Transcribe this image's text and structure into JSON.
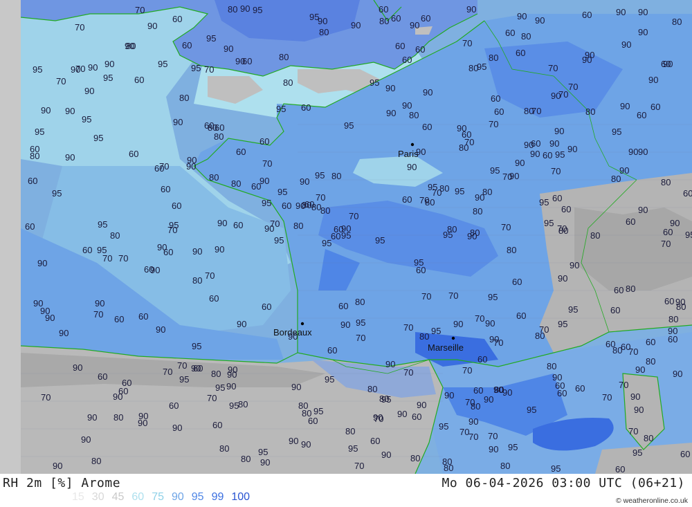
{
  "footer": {
    "title": "RH 2m [%] Arome",
    "datetime": "Mo 06-04-2026 03:00 UTC (06+21)",
    "credit_icon": "copyright-icon",
    "credit": "© weatheronline.co.uk"
  },
  "legend": [
    {
      "label": "15",
      "color": "#e8e8e8"
    },
    {
      "label": "30",
      "color": "#d8d8d8"
    },
    {
      "label": "45",
      "color": "#c9c9c9"
    },
    {
      "label": "60",
      "color": "#aee0ee"
    },
    {
      "label": "75",
      "color": "#8fd1e8"
    },
    {
      "label": "90",
      "color": "#6ea4e6"
    },
    {
      "label": "95",
      "color": "#4f86e6"
    },
    {
      "label": "99",
      "color": "#3a6ee0"
    },
    {
      "label": "100",
      "color": "#2a55d2"
    }
  ],
  "cities": [
    {
      "name": "Paris"
    },
    {
      "name": "Bordeaux"
    },
    {
      "name": "Marseille"
    }
  ],
  "labels": [
    "80",
    "80",
    "70",
    "90",
    "90",
    "90",
    "90",
    "80",
    "70",
    "70",
    "95",
    "90",
    "80",
    "90",
    "80",
    "70",
    "60",
    "95",
    "90",
    "80",
    "95",
    "90",
    "80",
    "80",
    "60",
    "80",
    "70",
    "95",
    "90",
    "95",
    "95",
    "90",
    "80",
    "60",
    "70",
    "95",
    "95",
    "90",
    "95",
    "70",
    "95",
    "90",
    "80",
    "90",
    "95",
    "95",
    "80",
    "95",
    "90",
    "80",
    "70",
    "90",
    "95",
    "95",
    "95",
    "95",
    "90",
    "80",
    "80",
    "95",
    "90",
    "80",
    "90",
    "90",
    "80",
    "70",
    "95",
    "90",
    "80",
    "90",
    "90",
    "90",
    "70",
    "90",
    "80",
    "95",
    "90",
    "80",
    "95",
    "95",
    "90",
    "90",
    "80",
    "95",
    "95",
    "90",
    "90",
    "90",
    "90",
    "80",
    "95",
    "90",
    "90",
    "80",
    "90",
    "70",
    "90",
    "80",
    "80",
    "95",
    "90",
    "80",
    "90",
    "80",
    "70",
    "95",
    "95",
    "90",
    "80",
    "90",
    "90",
    "80",
    "80",
    "95",
    "90",
    "90",
    "70",
    "60",
    "70",
    "90",
    "95",
    "95",
    "90",
    "95",
    "90",
    "90",
    "80",
    "70",
    "60",
    "60",
    "70",
    "80",
    "90",
    "95",
    "90",
    "95",
    "90",
    "90",
    "80",
    "60",
    "60",
    "70",
    "90",
    "95",
    "95",
    "90",
    "90",
    "80",
    "70",
    "80",
    "80",
    "90",
    "95",
    "90",
    "60",
    "70",
    "80",
    "90",
    "80",
    "90",
    "90",
    "90",
    "80",
    "80",
    "70",
    "90",
    "60",
    "90",
    "95",
    "60",
    "80",
    "90",
    "80",
    "80",
    "95",
    "60",
    "70",
    "80",
    "90",
    "90",
    "60",
    "70",
    "80",
    "90",
    "95",
    "90",
    "80",
    "90",
    "90",
    "95",
    "90",
    "95",
    "70",
    "70",
    "95",
    "80",
    "60",
    "70",
    "90",
    "60",
    "70",
    "90",
    "90",
    "95",
    "90",
    "60",
    "70",
    "60",
    "80",
    "90",
    "95",
    "90",
    "70",
    "60",
    "80",
    "90",
    "60",
    "60",
    "90",
    "95",
    "90",
    "80",
    "90",
    "90",
    "95",
    "60",
    "70",
    "90",
    "90",
    "80",
    "60",
    "60",
    "70",
    "60",
    "70",
    "90",
    "60",
    "60",
    "90",
    "70",
    "60",
    "60",
    "90",
    "90",
    "60",
    "80",
    "70",
    "70",
    "60",
    "60",
    "60",
    "70",
    "90",
    "80",
    "60",
    "80",
    "90",
    "80",
    "90",
    "90",
    "90",
    "95",
    "60",
    "60",
    "80",
    "60",
    "60",
    "90",
    "60",
    "70",
    "70",
    "60",
    "60",
    "60",
    "60",
    "70",
    "90",
    "60",
    "60",
    "60",
    "60",
    "90",
    "60",
    "60",
    "70",
    "70",
    "60",
    "60",
    "60",
    "60",
    "70",
    "60",
    "70",
    "70",
    "60",
    "60",
    "60",
    "90",
    "60",
    "70",
    "60",
    "60",
    "60",
    "70",
    "70",
    "90",
    "80",
    "60",
    "60",
    "95",
    "90",
    "60",
    "60",
    "70",
    "60",
    "80",
    "70",
    "80",
    "60",
    "95",
    "60",
    "90",
    "90",
    "90",
    "80",
    "60",
    "60",
    "95",
    "90",
    "60",
    "80",
    "90",
    "90",
    "80",
    "60",
    "70",
    "90",
    "70",
    "60",
    "60",
    "60",
    "80",
    "60",
    "60",
    "60",
    "90",
    "60",
    "70",
    "60",
    "90",
    "60",
    "90",
    "90",
    "60",
    "70",
    "95",
    "80",
    "90",
    "90",
    "95",
    "95",
    "90",
    "80"
  ]
}
